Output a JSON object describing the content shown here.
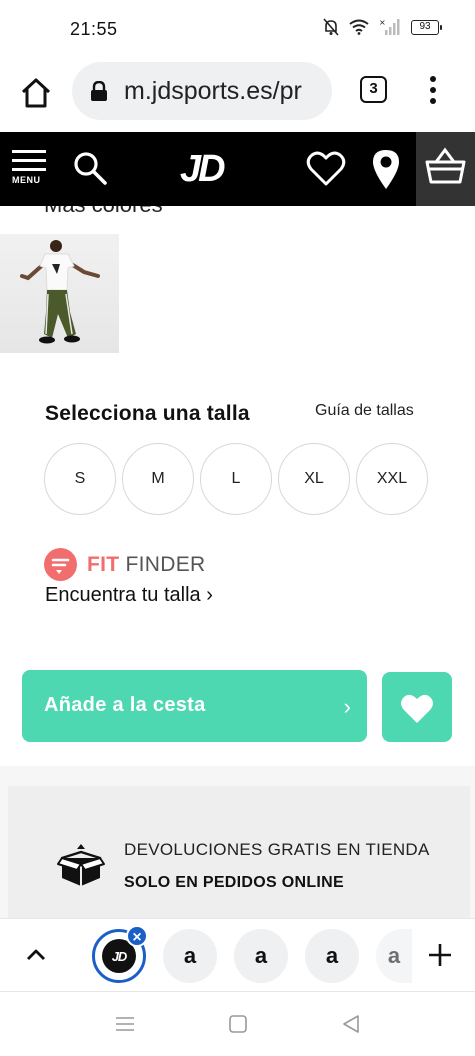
{
  "status_bar": {
    "time": "21:55",
    "battery": "93"
  },
  "browser": {
    "url": "m.jdsports.es/pr",
    "tab_count": "3"
  },
  "header": {
    "menu_label": "MENU",
    "logo": "JD"
  },
  "product": {
    "clipped_heading": "Más colores",
    "size_title": "Selecciona una talla",
    "size_guide": "Guía de tallas",
    "sizes": [
      "S",
      "M",
      "L",
      "XL",
      "XXL"
    ]
  },
  "fit_finder": {
    "brand_strong": "FIT",
    "brand_rest": " FINDER",
    "link": "Encuentra tu talla ›"
  },
  "cta": {
    "add_label": "Añade a la cesta",
    "chevron": "›"
  },
  "returns": {
    "title": "DEVOLUCIONES GRATIS EN TIENDA",
    "subtitle": "SOLO EN PEDIDOS ONLINE"
  },
  "tabs": {
    "active_label": "JD",
    "amazon_letter": "a"
  },
  "colors": {
    "accent": "#4ed8b2",
    "fit_finder": "#f26d6d",
    "tab_active": "#1a5fc8",
    "header_bg": "#000000"
  },
  "icons": [
    "home-icon",
    "lock-icon",
    "more-icon",
    "menu-icon",
    "search-icon",
    "heart-icon",
    "location-pin-icon",
    "basket-icon",
    "box-icon",
    "chevron-up-icon",
    "plus-icon",
    "recent-apps-icon",
    "home-nav-icon",
    "back-icon"
  ]
}
